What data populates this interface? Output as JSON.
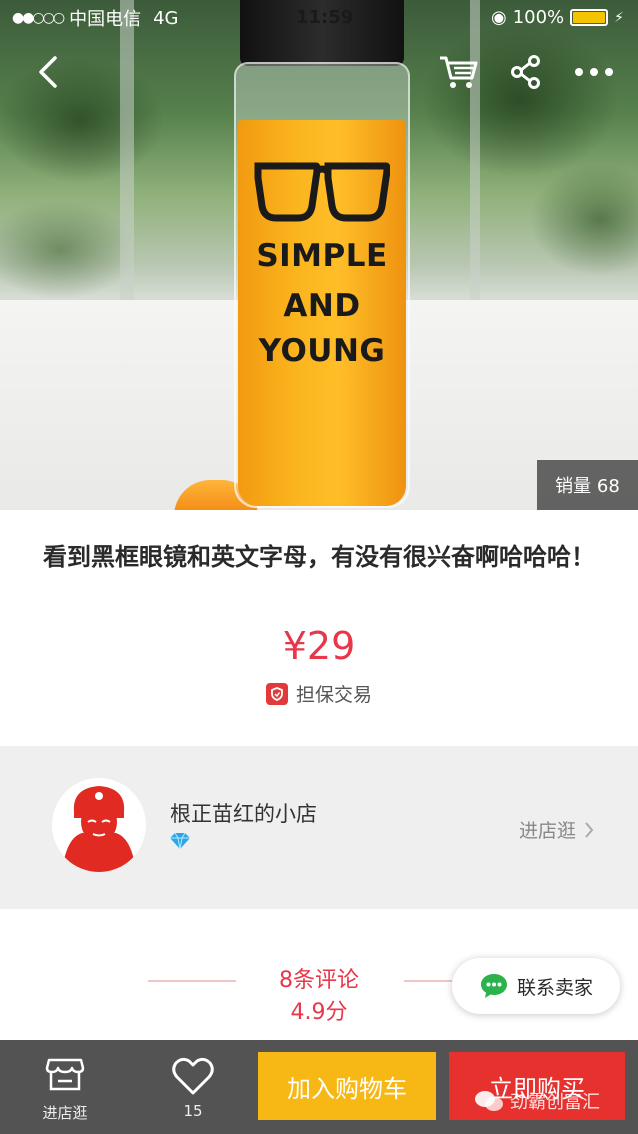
{
  "status_bar": {
    "signal": "●●○○○",
    "carrier": "中国电信",
    "network": "4G",
    "time": "11:59",
    "battery": "100%"
  },
  "product": {
    "sales": "销量 68",
    "bottle_line1": "SIMPLE",
    "bottle_line2": "AND",
    "bottle_line3": "YOUNG",
    "title": "看到黑框眼镜和英文字母，有没有很兴奋啊哈哈哈！",
    "price": "¥29",
    "guarantee": "担保交易"
  },
  "shop": {
    "name": "根正苗红的小店",
    "visit": "进店逛"
  },
  "reviews": {
    "count": "8条评论",
    "score": "4.9分",
    "contact": "联系卖家"
  },
  "bottom_bar": {
    "store_label": "进店逛",
    "favorite_count": "15",
    "add_to_cart": "加入购物车",
    "buy_now": "立即购买"
  },
  "watermark": "劲霸创富汇",
  "colors": {
    "price_red": "#e8364a",
    "cart_yellow": "#f7b714",
    "buy_red": "#e6312e",
    "wechat_green": "#2bb24c"
  },
  "icons": [
    "back-icon",
    "cart-icon",
    "share-icon",
    "more-icon",
    "shield-icon",
    "diamond-icon",
    "chevron-right-icon",
    "chat-icon",
    "store-icon",
    "heart-icon"
  ]
}
